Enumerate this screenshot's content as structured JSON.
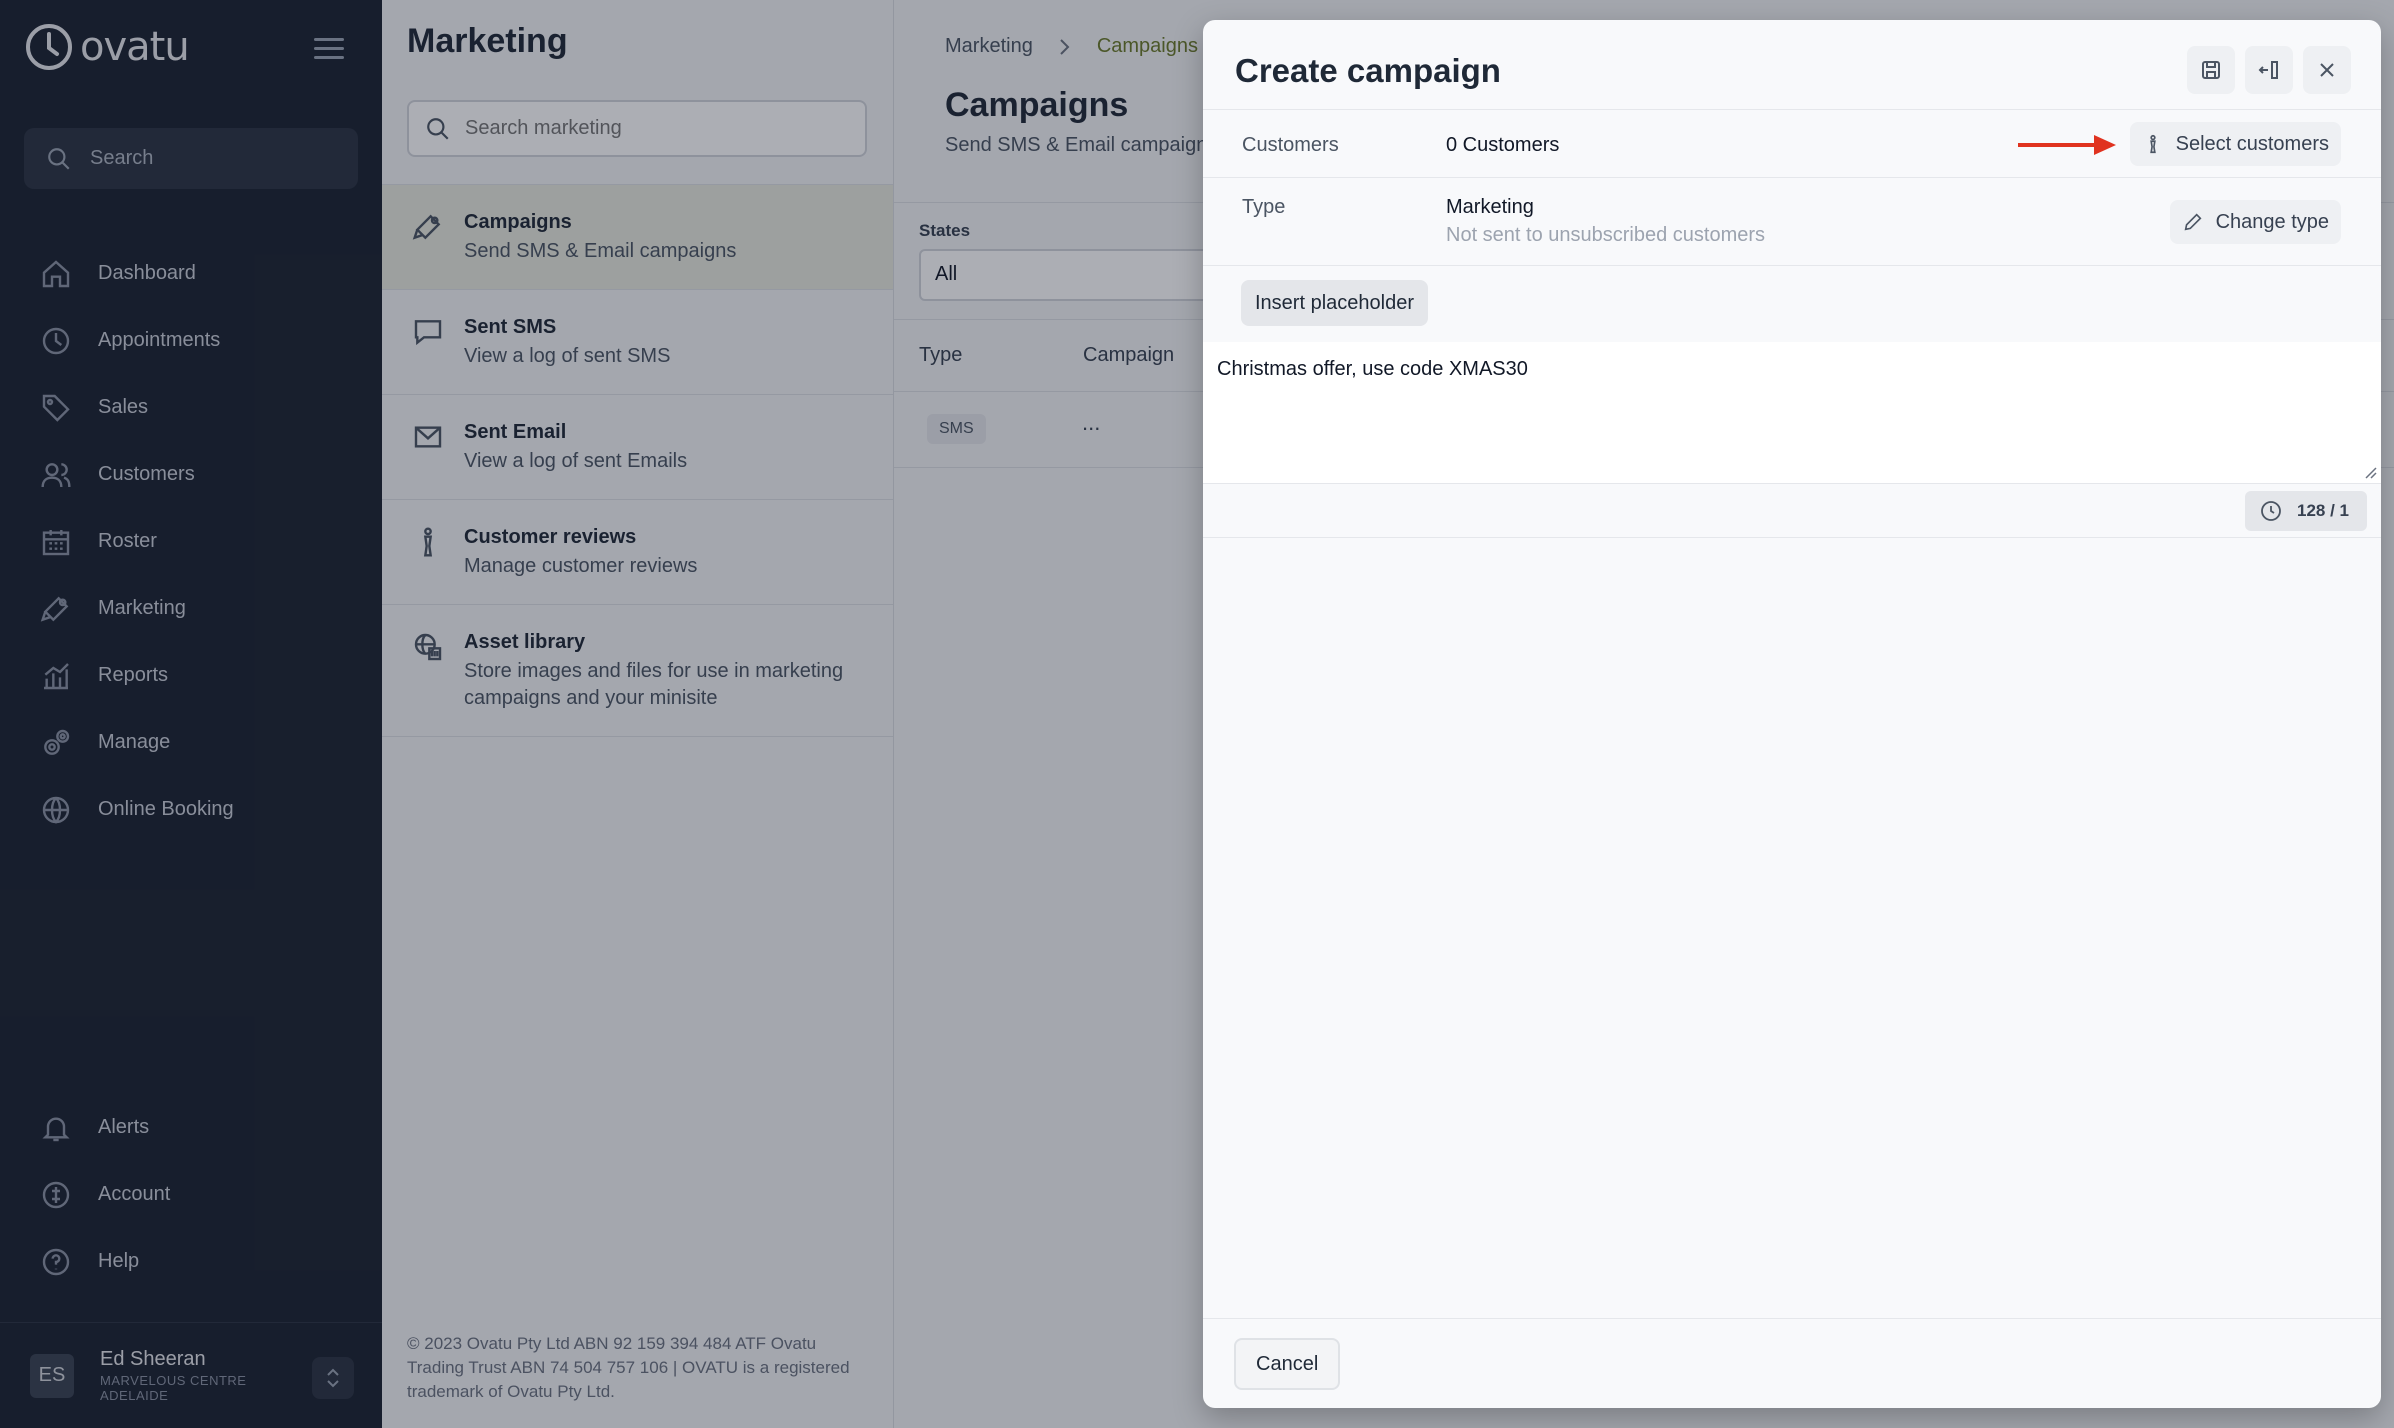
{
  "app": {
    "brand": "ovatu",
    "search_label": "Search"
  },
  "nav": {
    "items": [
      {
        "label": "Dashboard",
        "icon": "home-icon"
      },
      {
        "label": "Appointments",
        "icon": "clock-icon"
      },
      {
        "label": "Sales",
        "icon": "tag-icon"
      },
      {
        "label": "Customers",
        "icon": "users-icon"
      },
      {
        "label": "Roster",
        "icon": "calendar-icon"
      },
      {
        "label": "Marketing",
        "icon": "megaphone-icon"
      },
      {
        "label": "Reports",
        "icon": "chart-icon"
      },
      {
        "label": "Manage",
        "icon": "gears-icon"
      },
      {
        "label": "Online Booking",
        "icon": "globe-icon"
      }
    ],
    "bottom": [
      {
        "label": "Alerts",
        "icon": "bell-icon"
      },
      {
        "label": "Account",
        "icon": "account-icon"
      },
      {
        "label": "Help",
        "icon": "help-icon"
      }
    ]
  },
  "user": {
    "initials": "ES",
    "name": "Ed Sheeran",
    "location": "MARVELOUS CENTRE ADELAIDE"
  },
  "marketing": {
    "title": "Marketing",
    "search_placeholder": "Search marketing",
    "items": [
      {
        "title": "Campaigns",
        "desc": "Send SMS & Email campaigns"
      },
      {
        "title": "Sent SMS",
        "desc": "View a log of sent SMS"
      },
      {
        "title": "Sent Email",
        "desc": "View a log of sent Emails"
      },
      {
        "title": "Customer reviews",
        "desc": "Manage customer reviews"
      },
      {
        "title": "Asset library",
        "desc": "Store images and files for use in marketing campaigns and your minisite"
      }
    ],
    "footer": "© 2023 Ovatu Pty Ltd ABN 92 159 394 484 ATF Ovatu Trading Trust ABN 74 504 757 106 | OVATU is a registered trademark of Ovatu Pty Ltd."
  },
  "campaigns": {
    "breadcrumb_root": "Marketing",
    "breadcrumb_current": "Campaigns",
    "title": "Campaigns",
    "subtitle": "Send SMS & Email campaign",
    "states_label": "States",
    "states_value": "All",
    "columns": [
      "Type",
      "Campaign"
    ],
    "rows": [
      {
        "type": "SMS",
        "campaign": "..."
      }
    ]
  },
  "drawer": {
    "title": "Create campaign",
    "customers_label": "Customers",
    "customers_value": "0 Customers",
    "select_customers": "Select customers",
    "type_label": "Type",
    "type_value": "Marketing",
    "type_note": "Not sent to unsubscribed customers",
    "change_type": "Change type",
    "insert_placeholder": "Insert placeholder",
    "message": "Christmas offer, use code XMAS30",
    "counter": "128 / 1",
    "cancel": "Cancel"
  },
  "colors": {
    "sidebar_bg": "#1b2230",
    "annotation_arrow": "#e0331f",
    "breadcrumb_current": "#6b7a2a"
  }
}
